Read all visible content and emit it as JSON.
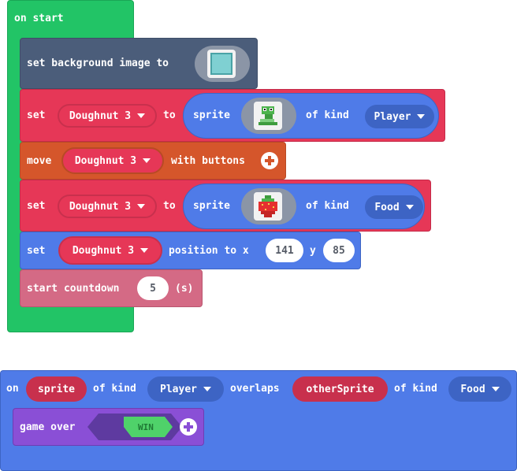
{
  "colors": {
    "events": "#22c466",
    "scene": "#4b5d7a",
    "sprites": "#e63757",
    "sprites_dark": "#c8304d",
    "controller": "#d5562b",
    "controller_dark": "#b84a25",
    "blue": "#4f7be8",
    "blue_dark": "#3d64c4",
    "info": "#d46a85",
    "game": "#8a4fd6",
    "game_dark": "#5e3aa0",
    "win": "#4fd26a"
  },
  "on_start": {
    "label": "on start",
    "bg_block": {
      "label": "set background image to",
      "icon": "image-thumbnail"
    },
    "set_player": {
      "set": "set",
      "var": "Doughnut 3",
      "to": "to",
      "sprite": "sprite",
      "image": "snake-sprite",
      "of_kind": "of kind",
      "kind": "Player"
    },
    "move": {
      "label": "move",
      "var": "Doughnut 3",
      "with_buttons": "with buttons"
    },
    "set_food": {
      "set": "set",
      "var": "Doughnut 3",
      "to": "to",
      "sprite": "sprite",
      "image": "strawberry-sprite",
      "of_kind": "of kind",
      "kind": "Food"
    },
    "position": {
      "set": "set",
      "var": "Doughnut 3",
      "label": "position to x",
      "x": "141",
      "y_label": "y",
      "y": "85"
    },
    "countdown": {
      "label": "start countdown",
      "value": "5",
      "unit": "(s)"
    }
  },
  "overlap": {
    "on": "on",
    "sprite": "sprite",
    "of_kind": "of kind",
    "kind1": "Player",
    "overlaps": "overlaps",
    "other": "otherSprite",
    "of_kind2": "of kind",
    "kind2": "Food",
    "game_over": "game over",
    "win": "WIN"
  }
}
